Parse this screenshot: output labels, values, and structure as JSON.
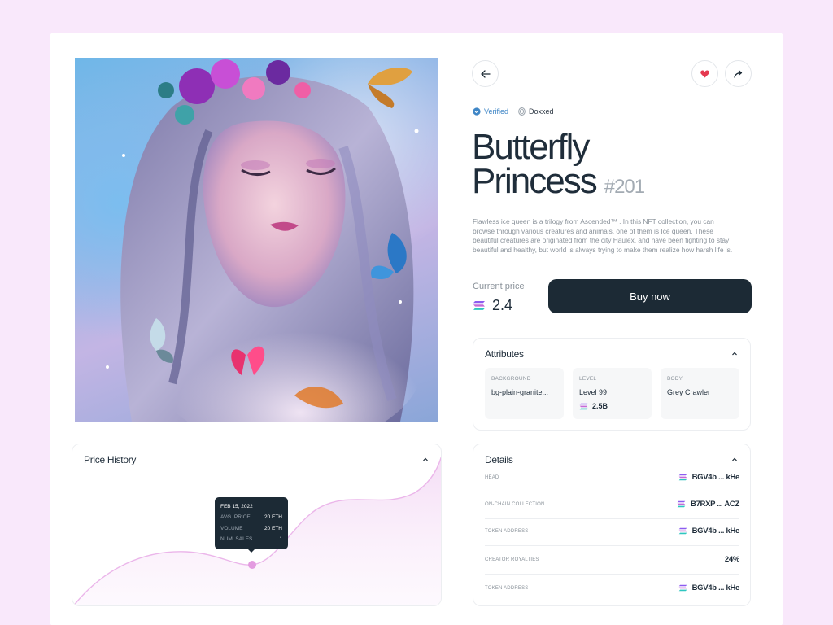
{
  "nav": {
    "back_icon": "arrow-left-icon",
    "like_icon": "heart-icon",
    "share_icon": "share-icon"
  },
  "badges": {
    "verified": "Verified",
    "doxxed": "Doxxed"
  },
  "nft": {
    "title_line1": "Butterfly",
    "title_line2": "Princess",
    "number": "#201",
    "description": "Flawless ice queen is a trilogy from Ascended™ . In this NFT collection, you can browse through various creatures and animals, one of them is Ice queen. These beautiful creatures are originated from the city Haulex, and have been fighting to stay beautiful and healthy, but world is always trying to make them realize how harsh life is."
  },
  "price": {
    "label": "Current price",
    "value": "2.4",
    "buy_label": "Buy now"
  },
  "attributes": {
    "title": "Attributes",
    "items": [
      {
        "key": "BACKGROUND",
        "value": "bg-plain-granite..."
      },
      {
        "key": "LEVEL",
        "value": "Level 99",
        "sub": "2.5B"
      },
      {
        "key": "BODY",
        "value": "Grey Crawler"
      }
    ]
  },
  "details": {
    "title": "Details",
    "rows": [
      {
        "key": "HEAD",
        "value": "BGV4b ... kHe",
        "icon": true
      },
      {
        "key": "ON-CHAIN COLLECTION",
        "value": "B7RXP ... ACZ",
        "icon": true
      },
      {
        "key": "TOKEN ADDRESS",
        "value": "BGV4b ... kHe",
        "icon": true
      },
      {
        "key": "CREATOR ROYALTIES",
        "value": "24%",
        "icon": false
      },
      {
        "key": "TOKEN ADDRESS",
        "value": "BGV4b ... kHe",
        "icon": true
      }
    ]
  },
  "price_history": {
    "title": "Price History",
    "tooltip": {
      "date": "FEB 15, 2022",
      "rows": [
        {
          "key": "AVG. PRICE",
          "value": "20 ETH"
        },
        {
          "key": "VOLUME",
          "value": "20 ETH"
        },
        {
          "key": "NUM. SALES",
          "value": "1"
        }
      ]
    }
  },
  "colors": {
    "dark": "#1c2a35",
    "accent_pink": "#e6a4e3",
    "verified_blue": "#3f86c6",
    "heart_red": "#e53950"
  }
}
